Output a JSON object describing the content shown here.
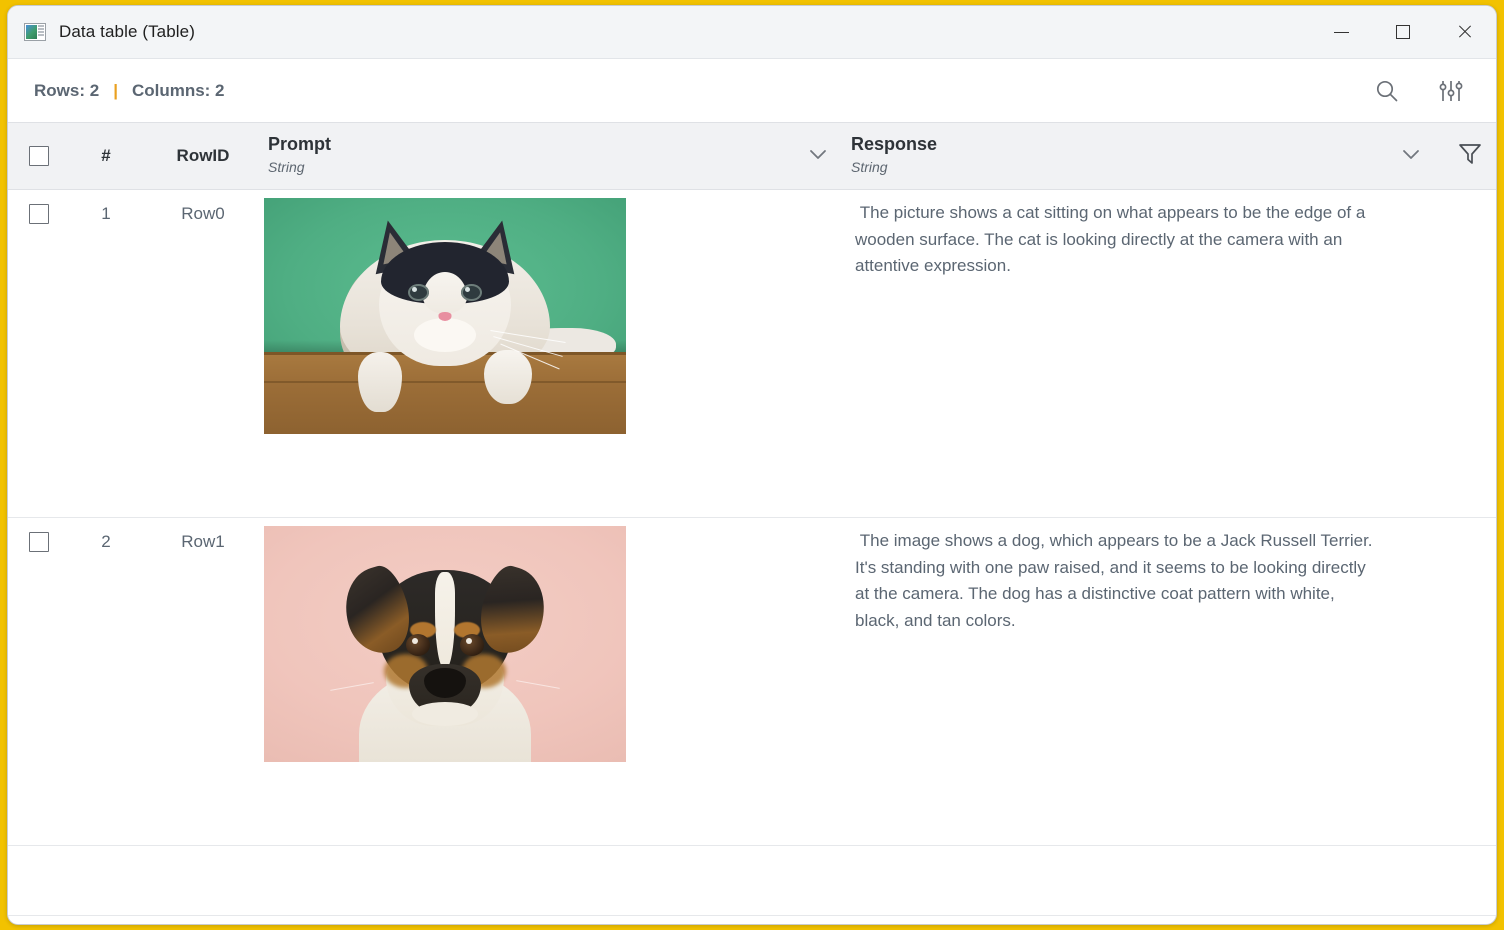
{
  "window": {
    "title": "Data table (Table)",
    "app_icon": "table-window-icon",
    "controls": {
      "minimize": "minimize-icon",
      "maximize": "maximize-icon",
      "close": "close-icon"
    },
    "accent_color": "#f2c200"
  },
  "infobar": {
    "rows_label": "Rows: 2",
    "separator": "|",
    "columns_label": "Columns: 2",
    "search_icon": "search-icon",
    "settings_icon": "sliders-settings-icon"
  },
  "table": {
    "columns": [
      {
        "key": "check",
        "label": "",
        "type": ""
      },
      {
        "key": "num",
        "label": "#",
        "type": ""
      },
      {
        "key": "rowid",
        "label": "RowID",
        "type": ""
      },
      {
        "key": "prompt",
        "label": "Prompt",
        "type": "String"
      },
      {
        "key": "resp",
        "label": "Response",
        "type": "String"
      }
    ],
    "header_icons": {
      "prompt_chevron": "chevron-down-icon",
      "response_chevron": "chevron-down-icon",
      "filter": "funnel-filter-icon"
    },
    "rows": [
      {
        "num": "1",
        "rowid": "Row0",
        "prompt_image": "cat-photo",
        "response": " The picture shows a cat sitting on what appears to be the edge of a wooden surface. The cat is looking directly at the camera with an attentive expression."
      },
      {
        "num": "2",
        "rowid": "Row1",
        "prompt_image": "dog-photo",
        "response": " The image shows a dog, which appears to be a Jack Russell Terrier. It's standing with one paw raised, and it seems to be looking directly at the camera. The dog has a distinctive coat pattern with white, black, and tan colors."
      }
    ]
  },
  "colors": {
    "accent": "#f2c200",
    "text_muted": "#5b6672",
    "header_text": "#2e3338",
    "header_bg": "#f1f2f4",
    "cat_bg": "#4fae83",
    "dog_bg": "#f0c5bc"
  }
}
